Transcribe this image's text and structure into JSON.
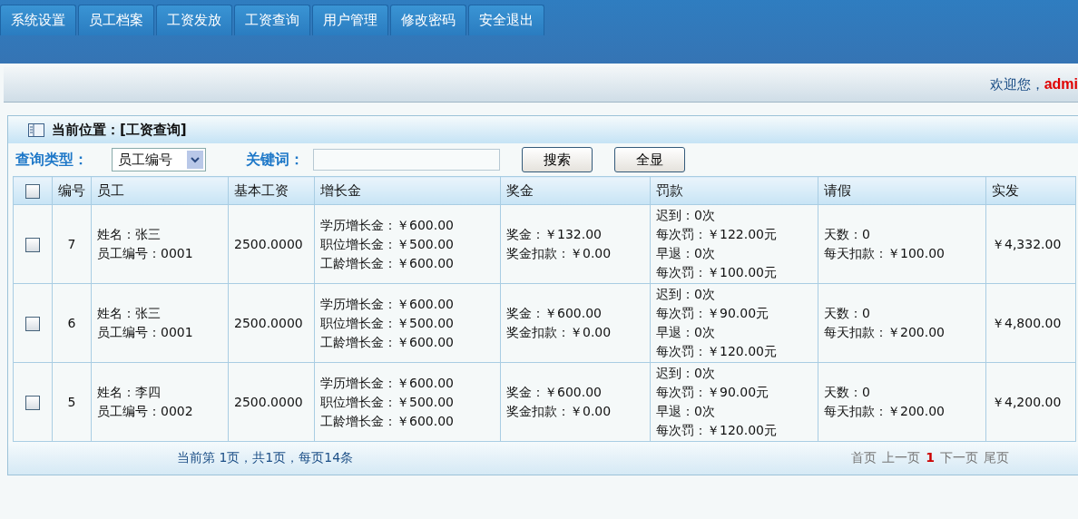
{
  "nav_tabs": [
    "系统设置",
    "员工档案",
    "工资发放",
    "工资查询",
    "用户管理",
    "修改密码",
    "安全退出"
  ],
  "welcome": {
    "text": "欢迎您，",
    "user": "admi"
  },
  "panel": {
    "title": "当前位置：[工资查询]"
  },
  "search": {
    "type_label": "查询类型：",
    "type_value": "员工编号",
    "keyword_label": "关键词：",
    "buttons": [
      "搜索",
      "全显"
    ]
  },
  "table": {
    "select_all_checked": false,
    "columns": [
      "编号",
      "员工",
      "基本工资",
      "增长金",
      "奖金",
      "罚款",
      "请假",
      "实发"
    ],
    "rows": [
      {
        "checked": false,
        "id": "7",
        "employee": [
          "姓名：张三",
          "员工编号：0001"
        ],
        "base": "2500.0000",
        "growth": [
          "学历增长金：￥600.00",
          "职位增长金：￥500.00",
          "工龄增长金：￥600.00"
        ],
        "bonus": [
          "奖金：￥132.00",
          "奖金扣款：￥0.00"
        ],
        "penalty": [
          "迟到：0次",
          "每次罚：￥122.00元",
          "早退：0次",
          "每次罚：￥100.00元"
        ],
        "leave": [
          "天数：0",
          "每天扣款：￥100.00"
        ],
        "net": "￥4,332.00"
      },
      {
        "checked": false,
        "id": "6",
        "employee": [
          "姓名：张三",
          "员工编号：0001"
        ],
        "base": "2500.0000",
        "growth": [
          "学历增长金：￥600.00",
          "职位增长金：￥500.00",
          "工龄增长金：￥600.00"
        ],
        "bonus": [
          "奖金：￥600.00",
          "奖金扣款：￥0.00"
        ],
        "penalty": [
          "迟到：0次",
          "每次罚：￥90.00元",
          "早退：0次",
          "每次罚：￥120.00元"
        ],
        "leave": [
          "天数：0",
          "每天扣款：￥200.00"
        ],
        "net": "￥4,800.00"
      },
      {
        "checked": false,
        "id": "5",
        "employee": [
          "姓名：李四",
          "员工编号：0002"
        ],
        "base": "2500.0000",
        "growth": [
          "学历增长金：￥600.00",
          "职位增长金：￥500.00",
          "工龄增长金：￥600.00"
        ],
        "bonus": [
          "奖金：￥600.00",
          "奖金扣款：￥0.00"
        ],
        "penalty": [
          "迟到：0次",
          "每次罚：￥90.00元",
          "早退：0次",
          "每次罚：￥120.00元"
        ],
        "leave": [
          "天数：0",
          "每天扣款：￥200.00"
        ],
        "net": "￥4,200.00"
      }
    ]
  },
  "footer": {
    "info": "当前第 1页，共1页，每页14条",
    "pager": [
      {
        "label": "首页",
        "selected": false
      },
      {
        "label": "上一页",
        "selected": false
      },
      {
        "label": "1",
        "selected": true
      },
      {
        "label": "下一页",
        "selected": false
      },
      {
        "label": "尾页",
        "selected": false
      }
    ]
  }
}
